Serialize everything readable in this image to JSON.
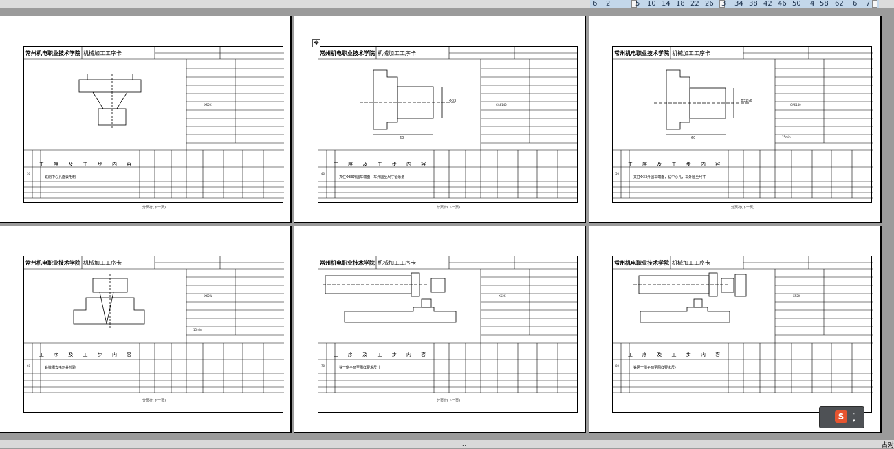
{
  "ruler": {
    "ticks": [
      "6",
      "2",
      "5",
      "10",
      "14",
      "18",
      "22",
      "26",
      "3",
      "34",
      "38",
      "42",
      "46",
      "50",
      "4",
      "58",
      "62",
      "6",
      "7"
    ]
  },
  "pages": [
    {
      "college": "常州机电职业技术学院",
      "doc_title": "机械加工工序卡",
      "section_header": "工 序 及 工 步 内 容",
      "row_no": "30",
      "row_text": "铣削中心孔面去毛刺",
      "footer": "分页符(下一页)"
    },
    {
      "college": "常州机电职业技术学院",
      "doc_title": "机械加工工序卡",
      "section_header": "工 序 及 工 步 内 容",
      "row_no": "40",
      "row_text": "夹住Φ33外圆车端面，车外圆至尺寸留余量",
      "footer": "分页符(下一页)"
    },
    {
      "college": "常州机电职业技术学院",
      "doc_title": "机械加工工序卡",
      "section_header": "工 序 及 工 步 内 容",
      "row_no": "50",
      "row_text": "夹住Φ33外圆车端面，钻中心孔，车外圆至尺寸",
      "footer": "分页符(下一页)"
    },
    {
      "college": "常州机电职业技术学院",
      "doc_title": "机械加工工序卡",
      "section_header": "工 序 及 工 步 内 容",
      "row_no": "60",
      "row_text": "铣键槽去毛刺并检验",
      "footer": "分页符(下一页)"
    },
    {
      "college": "常州机电职业技术学院",
      "doc_title": "机械加工工序卡",
      "section_header": "工 序 及 工 步 内 容",
      "row_no": "70",
      "row_text": "铣一侧平面至图样要求尺寸",
      "footer": "分页符(下一页)"
    },
    {
      "college": "常州机电职业技术学院",
      "doc_title": "机械加工工序卡",
      "section_header": "工 序 及 工 步 内 容",
      "row_no": "80",
      "row_text": "铣另一侧平面至图样要求尺寸",
      "footer": ""
    }
  ],
  "side_labels": {
    "machine_1": "X52K",
    "machine_2": "CA6140",
    "machine_3": "CA6140",
    "machine_4": "X62W",
    "machine_5": "X52K",
    "machine_6": "X52K",
    "dim_2": "Φ33",
    "len_2": "60",
    "dim_3": "Φ32h6",
    "len_3": "60",
    "time_3": "15min",
    "time_4": "15min"
  },
  "status": {
    "dots": "...",
    "zoom": "占对"
  },
  "ime": {
    "logo": "S",
    "minus": "-",
    "caret": "▾"
  }
}
